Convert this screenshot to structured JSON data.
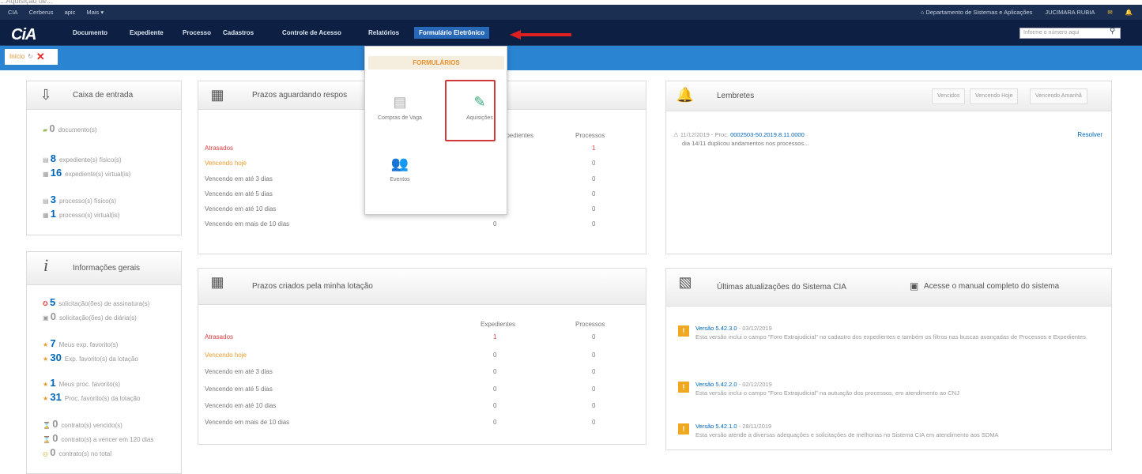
{
  "topcap": "...Aquisição de...",
  "top": {
    "cia": "CIA",
    "cerberus": "Cerberus",
    "apic": "apic",
    "mais": "Mais ▾",
    "dept": "Departamento de Sistemas e Aplicações",
    "user": "JUCIMARA RUBIA"
  },
  "nav": {
    "logo": "CiA",
    "items": [
      "Documento",
      "Expediente",
      "Processo",
      "Cadastros",
      "Controle de Acesso",
      "Relatórios",
      "Formulário Eletrônico"
    ],
    "search_placeholder": "Informe o número aqui"
  },
  "tab": {
    "label": "Início"
  },
  "dropdown": {
    "title": "FORMULÁRIOS",
    "items": [
      "Compras de Vaga",
      "Aquisições",
      "Eventos"
    ]
  },
  "caixa": {
    "title": "Caixa de entrada",
    "rows": [
      {
        "n": "0",
        "t": "documento(s)"
      },
      {
        "n": "8",
        "t": "expediente(s) físico(s)"
      },
      {
        "n": "16",
        "t": "expediente(s) virtual(is)"
      },
      {
        "n": "3",
        "t": "processo(s) físico(s)"
      },
      {
        "n": "1",
        "t": "processo(s) virtual(is)"
      }
    ]
  },
  "info": {
    "title": "Informações gerais",
    "rows": [
      {
        "n": "5",
        "t": "solicitação(ões) de assinatura(s)"
      },
      {
        "n": "0",
        "t": "solicitação(ões) de diária(s)"
      },
      {
        "n": "7",
        "t": "Meus exp. favorito(s)"
      },
      {
        "n": "30",
        "t": "Exp. favorito(s) da lotação"
      },
      {
        "n": "1",
        "t": "Meus proc. favorito(s)"
      },
      {
        "n": "31",
        "t": "Proc. favorito(s) da lotação"
      },
      {
        "n": "0",
        "t": "contrato(s) vencido(s)"
      },
      {
        "n": "0",
        "t": "contrato(s) a vencer em 120 dias"
      },
      {
        "n": "0",
        "t": "contrato(s) no total"
      }
    ]
  },
  "prazos1": {
    "title": "Prazos aguardando respos",
    "col1": "Expedientes",
    "col2": "Processos",
    "rows": [
      {
        "l": "Atrasados",
        "a": "",
        "b": "1"
      },
      {
        "l": "Vencendo hoje",
        "a": "",
        "b": "0"
      },
      {
        "l": "Vencendo em até 3 dias",
        "a": "",
        "b": "0"
      },
      {
        "l": "Vencendo em até 5 dias",
        "a": "",
        "b": "0"
      },
      {
        "l": "Vencendo em até 10 dias",
        "a": "",
        "b": "0"
      },
      {
        "l": "Vencendo em mais de 10 dias",
        "a": "0",
        "b": "0"
      }
    ]
  },
  "prazos2": {
    "title": "Prazos criados pela minha lotação",
    "col1": "Expedientes",
    "col2": "Processos",
    "rows": [
      {
        "l": "Atrasados",
        "a": "1",
        "b": "0"
      },
      {
        "l": "Vencendo hoje",
        "a": "0",
        "b": "0"
      },
      {
        "l": "Vencendo em até 3 dias",
        "a": "0",
        "b": "0"
      },
      {
        "l": "Vencendo em até 5 dias",
        "a": "0",
        "b": "0"
      },
      {
        "l": "Vencendo em até 10 dias",
        "a": "0",
        "b": "0"
      },
      {
        "l": "Vencendo em mais de 10 dias",
        "a": "0",
        "b": "0"
      }
    ]
  },
  "lembretes": {
    "title": "Lembretes",
    "tabs": [
      "Vencidos",
      "Vencendo Hoje",
      "Vencendo Amanhã"
    ],
    "date": "11/12/2019",
    "proc_prefix": "- Proc.",
    "proc": "0002503-50.2019.8.11.0000",
    "text": "dia 14/11 duplicou andamentos nos processos...",
    "action": "Resolver"
  },
  "updates": {
    "title": "Últimas atualizações do Sistema CIA",
    "manual": "Acesse o manual completo do sistema",
    "items": [
      {
        "v": "Versão 5.42.3.0",
        "d": "- 03/12/2019",
        "t": "Esta versão inclui o campo \"Foro Extrajudicial\" no cadastro dos expedientes e também os filtros nas buscas avançadas de Processos e Expedientes."
      },
      {
        "v": "Versão 5.42.2.0",
        "d": "- 02/12/2019",
        "t": "Esta versão inclui o campo \"Foro Extrajudicial\" na autuação dos processos, em atendimento ao CNJ"
      },
      {
        "v": "Versão 5.42.1.0",
        "d": "- 28/11/2019",
        "t": "Esta versão atende a diversas adequações e solicitações de melhorias no Sistema CIA em atendimento aos SDMA"
      }
    ]
  },
  "colors": {
    "navy": "#0d2044",
    "tabbar": "#2a84d2",
    "accent": "#e79030",
    "link": "#0066b8",
    "highlight": "#d23a3a"
  }
}
